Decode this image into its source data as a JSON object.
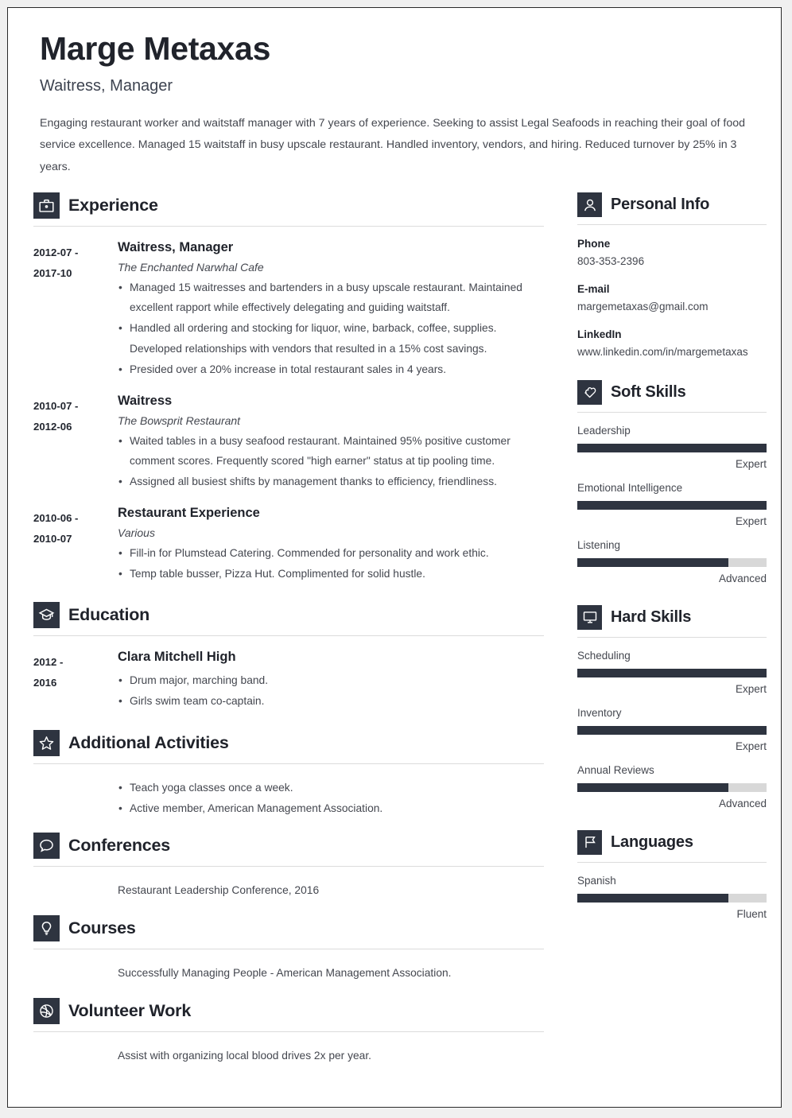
{
  "header": {
    "name": "Marge Metaxas",
    "title": "Waitress, Manager",
    "summary": "Engaging restaurant worker and waitstaff manager with 7 years of experience. Seeking to assist Legal Seafoods in reaching their goal of food service excellence. Managed 15 waitstaff in busy upscale restaurant. Handled inventory, vendors, and hiring. Reduced turnover by 25% in 3 years."
  },
  "colors": {
    "accent_dark": "#2e3440",
    "text_body": "#44474f",
    "text_heading": "#20232b",
    "bar_track": "#d8d8d8",
    "rule": "#dcdcdc"
  },
  "left": {
    "experience": {
      "icon": "briefcase-icon",
      "heading": "Experience",
      "entries": [
        {
          "date_start": "2012-07 -",
          "date_end": "2017-10",
          "role": "Waitress, Manager",
          "org": "The Enchanted Narwhal Cafe",
          "bullets": [
            "Managed 15 waitresses and bartenders in a busy upscale restaurant. Maintained excellent rapport while effectively delegating and guiding waitstaff.",
            "Handled all ordering and stocking for liquor, wine, barback, coffee, supplies. Developed relationships with vendors that resulted in a 15% cost savings.",
            "Presided over a 20% increase in total restaurant sales in 4 years."
          ]
        },
        {
          "date_start": "2010-07 -",
          "date_end": "2012-06",
          "role": "Waitress",
          "org": "The Bowsprit Restaurant",
          "bullets": [
            "Waited tables in a busy seafood restaurant. Maintained 95% positive customer comment scores. Frequently scored \"high earner\" status at tip pooling time.",
            "Assigned all busiest shifts by management thanks to efficiency, friendliness."
          ]
        },
        {
          "date_start": "2010-06 -",
          "date_end": "2010-07",
          "role": "Restaurant Experience",
          "org": "Various",
          "bullets": [
            "Fill-in for Plumstead Catering. Commended for personality and work ethic.",
            "Temp table busser, Pizza Hut. Complimented for solid hustle."
          ]
        }
      ]
    },
    "education": {
      "icon": "graduation-cap-icon",
      "heading": "Education",
      "entries": [
        {
          "date_start": "2012 -",
          "date_end": "2016",
          "role": "Clara Mitchell High",
          "org": "",
          "bullets": [
            "Drum major, marching band.",
            "Girls swim team co-captain."
          ]
        }
      ]
    },
    "additional_activities": {
      "icon": "star-icon",
      "heading": "Additional Activities",
      "bullets": [
        "Teach yoga classes once a week.",
        "Active member, American Management Association."
      ]
    },
    "conferences": {
      "icon": "speech-bubble-icon",
      "heading": "Conferences",
      "lines": [
        "Restaurant Leadership Conference, 2016"
      ]
    },
    "courses": {
      "icon": "lightbulb-icon",
      "heading": "Courses",
      "lines": [
        "Successfully Managing People - American Management Association."
      ]
    },
    "volunteer_work": {
      "icon": "basketball-icon",
      "heading": "Volunteer Work",
      "lines": [
        "Assist with organizing local blood drives 2x per year."
      ]
    }
  },
  "right": {
    "personal_info": {
      "icon": "person-icon",
      "heading": "Personal Info",
      "fields": [
        {
          "label": "Phone",
          "value": "803-353-2396"
        },
        {
          "label": "E-mail",
          "value": "margemetaxas@gmail.com"
        },
        {
          "label": "LinkedIn",
          "value": "www.linkedin.com/in/margemetaxas"
        }
      ]
    },
    "soft_skills": {
      "icon": "puzzle-heart-icon",
      "heading": "Soft Skills",
      "skills": [
        {
          "name": "Leadership",
          "level": "Expert",
          "percent": 100
        },
        {
          "name": "Emotional Intelligence",
          "level": "Expert",
          "percent": 100
        },
        {
          "name": "Listening",
          "level": "Advanced",
          "percent": 80
        }
      ]
    },
    "hard_skills": {
      "icon": "monitor-icon",
      "heading": "Hard Skills",
      "skills": [
        {
          "name": "Scheduling",
          "level": "Expert",
          "percent": 100
        },
        {
          "name": "Inventory",
          "level": "Expert",
          "percent": 100
        },
        {
          "name": "Annual Reviews",
          "level": "Advanced",
          "percent": 80
        }
      ]
    },
    "languages": {
      "icon": "flag-icon",
      "heading": "Languages",
      "skills": [
        {
          "name": "Spanish",
          "level": "Fluent",
          "percent": 80
        }
      ]
    }
  }
}
